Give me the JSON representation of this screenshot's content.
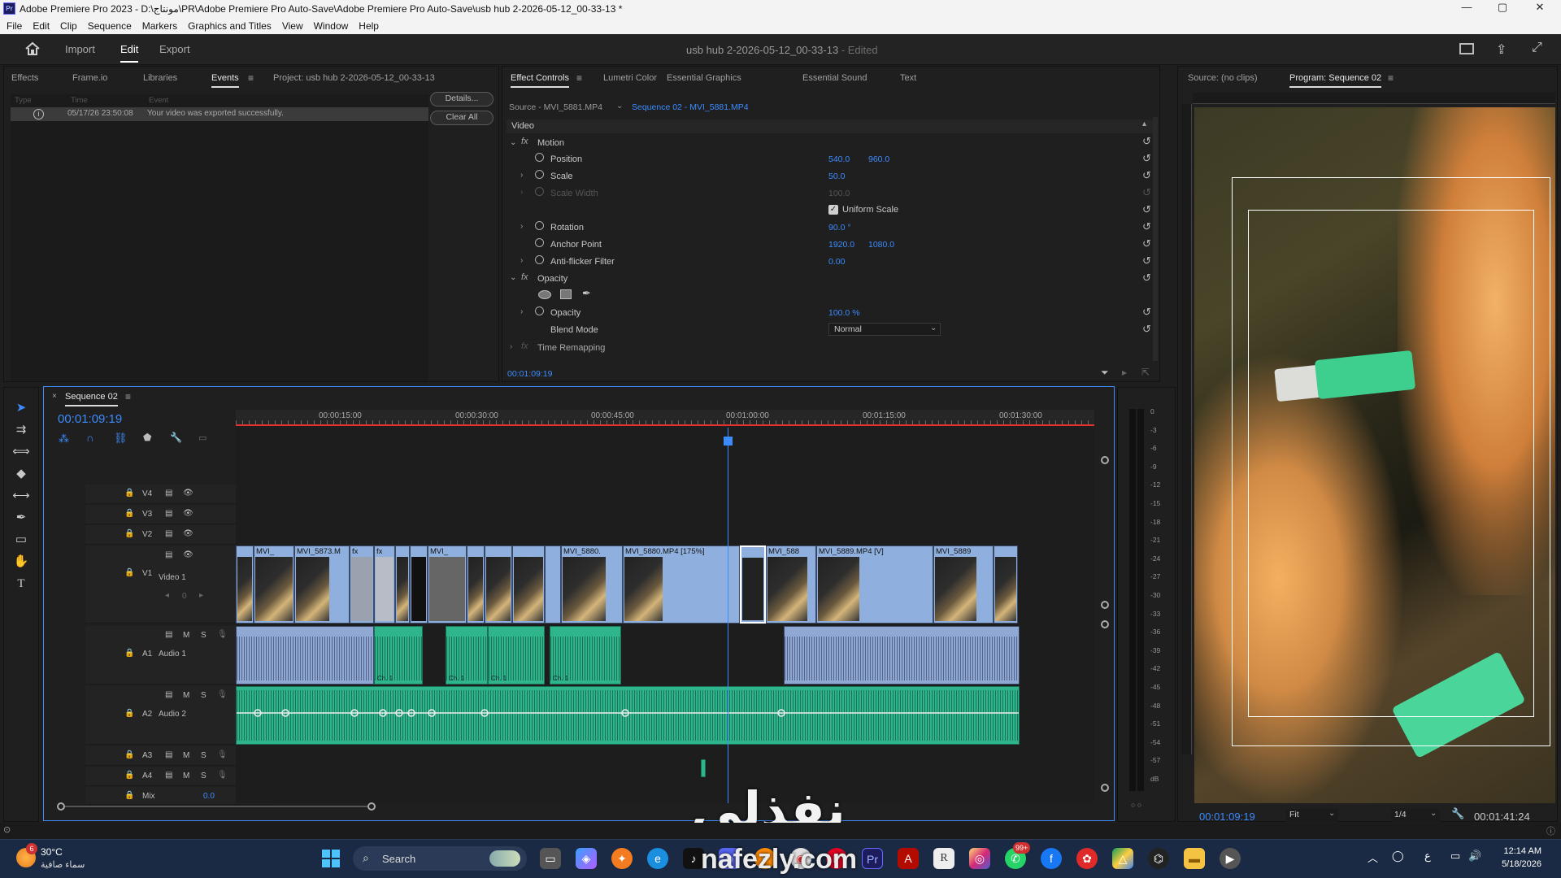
{
  "window": {
    "title": "Adobe Premiere Pro 2023 - D:\\مونتاج\\PR\\Adobe Premiere Pro Auto-Save\\Adobe Premiere Pro Auto-Save\\usb hub 2-2026-05-12_00-33-13 *",
    "app_badge": "Pr",
    "minimize": "—",
    "maximize": "▢",
    "close": "✕"
  },
  "menu": [
    "File",
    "Edit",
    "Clip",
    "Sequence",
    "Markers",
    "Graphics and Titles",
    "View",
    "Window",
    "Help"
  ],
  "header": {
    "home_icon": "home-icon",
    "workspaces": [
      "Import",
      "Edit",
      "Export"
    ],
    "active_workspace": "Edit",
    "document": "usb hub 2-2026-05-12_00-33-13",
    "edited": " - Edited"
  },
  "project_panel": {
    "tabs": [
      "Effects",
      "Frame.io",
      "Libraries",
      "Events",
      "Project: usb hub 2-2026-05-12_00-33-13"
    ],
    "active_tab": "Events",
    "columns": [
      "Type",
      "Time",
      "Event"
    ],
    "events": [
      {
        "time": "05/17/26 23:50:08",
        "message": "Your video was exported successfully."
      }
    ],
    "buttons": {
      "details": "Details...",
      "clear_all": "Clear All"
    }
  },
  "effect_controls": {
    "tabs": [
      "Effect Controls",
      "Lumetri Color",
      "Essential Graphics",
      "Essential Sound",
      "Text"
    ],
    "active_tab": "Effect Controls",
    "source": "Source - MVI_5881.MP4",
    "sequence": "Sequence 02 - MVI_5881.MP4",
    "section": "Video",
    "motion": "Motion",
    "position_label": "Position",
    "position_x": "540.0",
    "position_y": "960.0",
    "scale_label": "Scale",
    "scale": "50.0",
    "scale_width_label": "Scale Width",
    "scale_width": "100.0",
    "uniform_scale": "Uniform Scale",
    "rotation_label": "Rotation",
    "rotation": "90.0 °",
    "anchor_label": "Anchor Point",
    "anchor_x": "1920.0",
    "anchor_y": "1080.0",
    "antiflicker_label": "Anti-flicker Filter",
    "antiflicker": "0.00",
    "opacity_section": "Opacity",
    "opacity_label": "Opacity",
    "opacity": "100.0 %",
    "blend_label": "Blend Mode",
    "blend": "Normal",
    "time_remap": "Time Remapping",
    "timecode": "00:01:09:19"
  },
  "program_monitor": {
    "tabs": [
      "Source: (no clips)",
      "Program: Sequence 02"
    ],
    "active_tab": "Program: Sequence 02",
    "timecode": "00:01:09:19",
    "fit": "Fit",
    "resolution": "1/4",
    "duration": "00:01:41:24",
    "playhead_fraction": 0.685
  },
  "timeline": {
    "sequence": "Sequence 02",
    "timecode": "00:01:09:19",
    "ruler": [
      "00:00:15:00",
      "00:00:30:00",
      "00:00:45:00",
      "00:01:00:00",
      "00:01:15:00",
      "00:01:30:00"
    ],
    "video_tracks": [
      {
        "id": "V4",
        "name": ""
      },
      {
        "id": "V3",
        "name": ""
      },
      {
        "id": "V2",
        "name": ""
      },
      {
        "id": "V1",
        "name": "Video 1"
      }
    ],
    "audio_tracks": [
      {
        "id": "A1",
        "name": "Audio 1"
      },
      {
        "id": "A2",
        "name": "Audio 2"
      },
      {
        "id": "A3",
        "name": ""
      },
      {
        "id": "A4",
        "name": ""
      }
    ],
    "mix_label": "Mix",
    "mix_value": "0.0",
    "v1_keyframe_value": "0",
    "track_toggles": {
      "mute": "M",
      "solo": "S",
      "r": "R"
    },
    "clips_v1": [
      "MVI_",
      "MVI_5873.M",
      "fx",
      "fx",
      "MVI_",
      "",
      "",
      "MVI_5880.",
      "MVI_5880.MP4 [175%]",
      "",
      "MVI_588",
      "MVI_5889.MP4 [V]",
      "MVI_5889",
      ""
    ],
    "audio_clip_label": "Ch. 1"
  },
  "meter": {
    "ticks": [
      "0",
      "-3",
      "-6",
      "-9",
      "-12",
      "-15",
      "-18",
      "-21",
      "-24",
      "-27",
      "-30",
      "-33",
      "-36",
      "-39",
      "-42",
      "-45",
      "-48",
      "-51",
      "-54",
      "-57",
      "dB"
    ]
  },
  "watermark": {
    "arabic": "نفذلي",
    "latin": "nafezly.com"
  },
  "taskbar": {
    "weather_temp": "30°C",
    "weather_desc": "سماء صافية",
    "weather_badge": "6",
    "search": "Search",
    "time": "12:14 AM",
    "date": "5/18/2026",
    "lang": "ع",
    "whatsapp_badge": "99+"
  }
}
